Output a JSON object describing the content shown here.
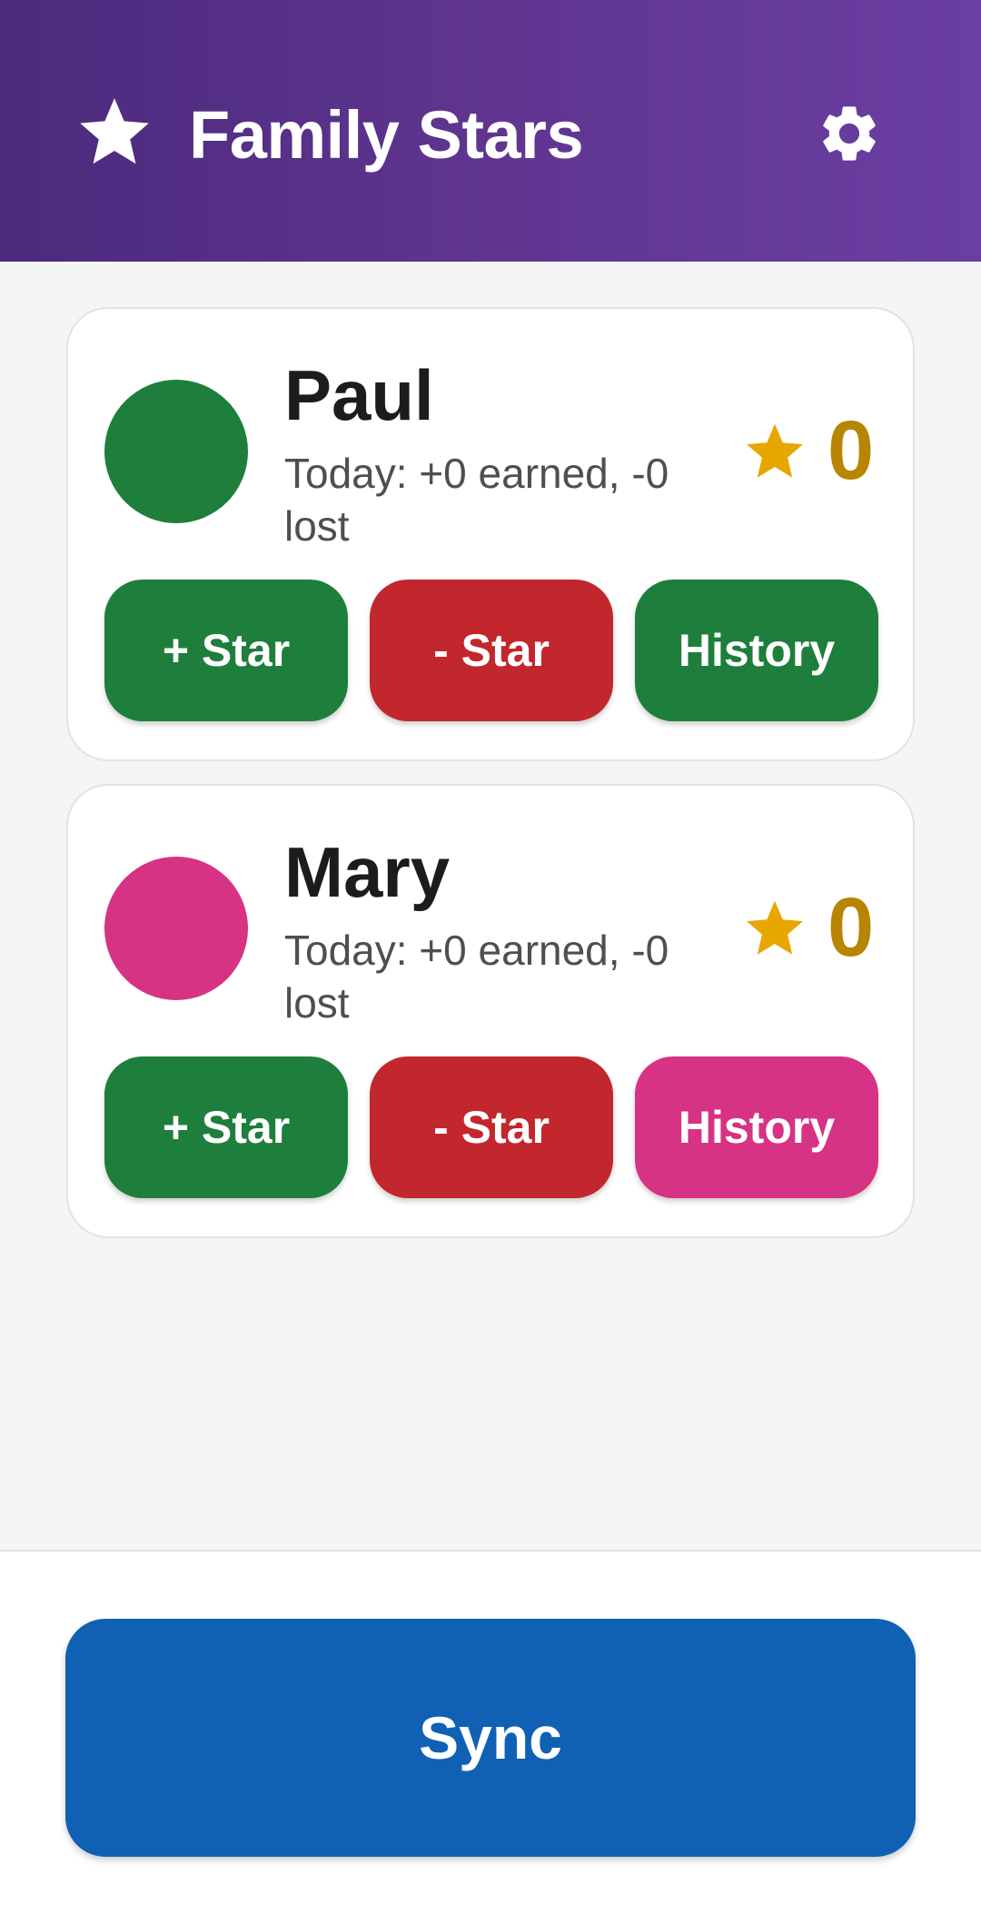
{
  "header": {
    "title": "Family Stars",
    "logo_icon": "star-icon",
    "settings_icon": "gear-icon"
  },
  "kids": [
    {
      "name": "Paul",
      "today": "Today: +0 earned, -0 lost",
      "count": "0",
      "avatar_color": "#1e7e3b",
      "add_label": "+ Star",
      "remove_label": "- Star",
      "history_label": "History",
      "history_color": "#1e7e3b"
    },
    {
      "name": "Mary",
      "today": "Today: +0 earned, -0 lost",
      "count": "0",
      "avatar_color": "#d63384",
      "add_label": "+ Star",
      "remove_label": "- Star",
      "history_label": "History",
      "history_color": "#d63384"
    }
  ],
  "footer": {
    "sync_label": "Sync"
  },
  "colors": {
    "accent_purple": "#5f3590",
    "star_gold": "#e8a600",
    "count_gold": "#b78500",
    "add_green": "#1e7e3b",
    "remove_red": "#c2272d",
    "sync_blue": "#1060b4"
  }
}
